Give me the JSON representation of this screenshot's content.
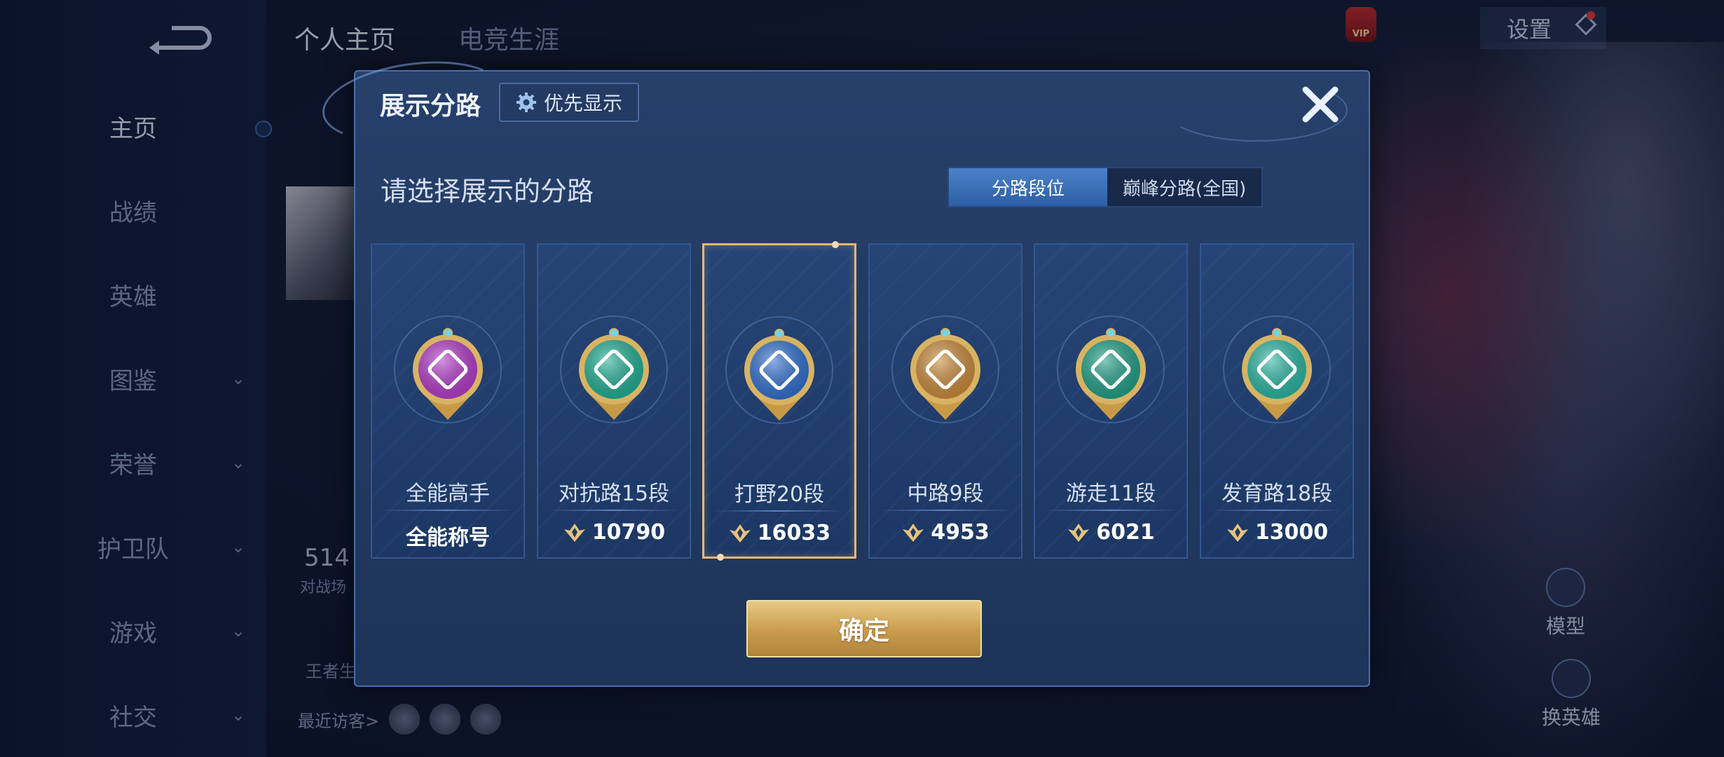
{
  "nav": {
    "items": [
      {
        "label": "主页",
        "active": true,
        "chevron": false
      },
      {
        "label": "战绩",
        "active": false,
        "chevron": false
      },
      {
        "label": "英雄",
        "active": false,
        "chevron": false
      },
      {
        "label": "图鉴",
        "active": false,
        "chevron": true
      },
      {
        "label": "荣誉",
        "active": false,
        "chevron": true
      },
      {
        "label": "护卫队",
        "active": false,
        "chevron": true
      },
      {
        "label": "游戏",
        "active": false,
        "chevron": true
      },
      {
        "label": "社交",
        "active": false,
        "chevron": true
      }
    ]
  },
  "header": {
    "tabs": [
      "个人主页",
      "电竞生涯"
    ],
    "settings_label": "设置",
    "vip_badge": "VIP"
  },
  "background": {
    "stat_value": "514",
    "stat_label": "对战场",
    "wz_label": "王者生",
    "visitors_label": "最近访客>",
    "model_label": "模型",
    "switch_hero_label": "换英雄"
  },
  "modal": {
    "title": "展示分路",
    "priority_label": "优先显示",
    "prompt": "请选择展示的分路",
    "segment": {
      "options": [
        "分路段位",
        "巅峰分路(全国)"
      ],
      "active_index": 0
    },
    "cards": [
      {
        "label": "全能高手",
        "value": "全能称号",
        "has_icon": false,
        "color": "#b33ac8",
        "selected": false
      },
      {
        "label": "对抗路15段",
        "value": "10790",
        "has_icon": true,
        "color": "#1fae93",
        "selected": false
      },
      {
        "label": "打野20段",
        "value": "16033",
        "has_icon": true,
        "color": "#2f6fcf",
        "selected": true
      },
      {
        "label": "中路9段",
        "value": "4953",
        "has_icon": true,
        "color": "#c98a3a",
        "selected": false
      },
      {
        "label": "游走11段",
        "value": "6021",
        "has_icon": true,
        "color": "#1f9f86",
        "selected": false
      },
      {
        "label": "发育路18段",
        "value": "13000",
        "has_icon": true,
        "color": "#28b5a2",
        "selected": false
      }
    ],
    "confirm_label": "确定"
  }
}
